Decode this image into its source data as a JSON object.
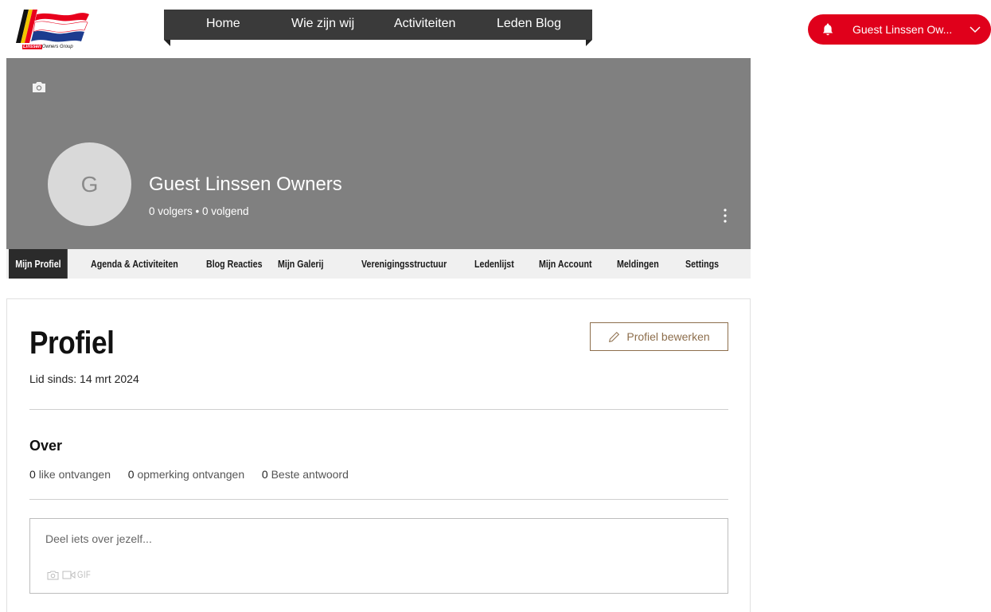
{
  "brand": {
    "logo_text_highlight": "Linssen",
    "logo_text_rest": "Owners Group",
    "colors": {
      "red": "#e8001c",
      "blue": "#1d3c8f",
      "yellow": "#f2c500",
      "black": "#111111"
    }
  },
  "topnav": {
    "items": [
      {
        "label": "Home"
      },
      {
        "label": "Wie zijn wij"
      },
      {
        "label": "Activiteiten"
      },
      {
        "label": "Leden Blog"
      }
    ]
  },
  "user_menu": {
    "name": "Guest Linssen Ow...",
    "icon": "bell-icon",
    "chevron": "chevron-down-icon",
    "color": "#e0001b"
  },
  "profile": {
    "cover_color": "#808080",
    "avatar_initial": "G",
    "name": "Guest Linssen Owners",
    "stats": "0 volgers • 0 volgend"
  },
  "tabs": [
    {
      "label": "Mijn Profiel",
      "active": true
    },
    {
      "label": "Agenda & Activiteiten"
    },
    {
      "label": "Blog Reacties"
    },
    {
      "label": "Mijn Galerij"
    },
    {
      "label": "Verenigingsstructuur"
    },
    {
      "label": "Ledenlijst"
    },
    {
      "label": "Mijn Account"
    },
    {
      "label": "Meldingen"
    },
    {
      "label": "Settings"
    }
  ],
  "main": {
    "title": "Profiel",
    "member_since": "Lid sinds: 14 mrt 2024",
    "edit_button": "Profiel bewerken",
    "about": {
      "title": "Over",
      "stats": [
        {
          "count": "0",
          "label": "like ontvangen"
        },
        {
          "count": "0",
          "label": "opmerking ontvangen"
        },
        {
          "count": "0",
          "label": "Beste antwoord"
        }
      ]
    },
    "composer": {
      "placeholder": "Deel iets over jezelf...",
      "gif_label": "GIF"
    }
  }
}
